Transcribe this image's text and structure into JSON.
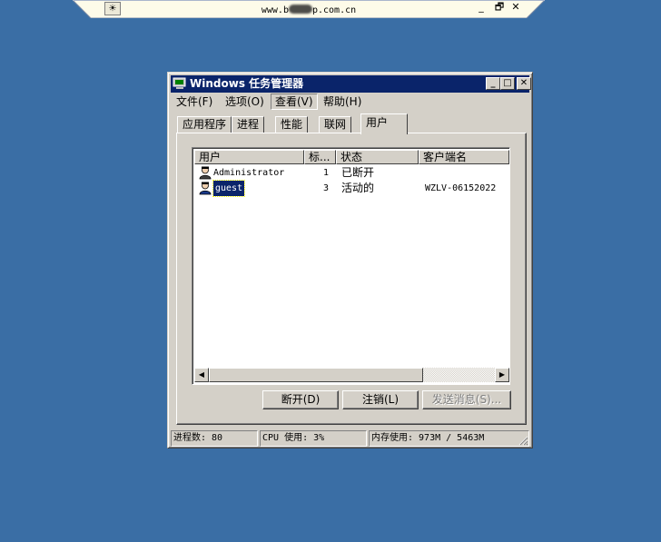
{
  "remote_bar": {
    "host_prefix": "www.b",
    "host_suffix": "p.com.cn",
    "pin_icon": "pushpin-icon",
    "minimize_glyph": "_",
    "restore_glyph": "🗗",
    "close_glyph": "✕"
  },
  "window": {
    "title": "Windows 任务管理器",
    "title_icon": "task-manager-icon",
    "minimize_glyph": "_",
    "maximize_glyph": "□",
    "close_glyph": "✕"
  },
  "menu": {
    "items": [
      "文件(F)",
      "选项(O)",
      "查看(V)",
      "帮助(H)"
    ]
  },
  "tabs": [
    "应用程序",
    "进程",
    "性能",
    "联网",
    "用户"
  ],
  "active_tab": "用户",
  "users_table": {
    "columns": [
      "用户",
      "标...",
      "状态",
      "客户端名"
    ],
    "rows": [
      {
        "user": "Administrator",
        "id": "1",
        "status": "已断开",
        "client": ""
      },
      {
        "user": "guest",
        "id": "3",
        "status": "活动的",
        "client": "WZLV-06152022"
      }
    ],
    "selected_row": 1
  },
  "buttons": {
    "disconnect": "断开(D)",
    "logoff": "注销(L)",
    "send_message": "发送消息(S)..."
  },
  "status_bar": {
    "processes": "进程数: 80",
    "cpu": "CPU 使用: 3%",
    "memory": "内存使用: 973M / 5463M"
  },
  "colors": {
    "desktop": "#3a6ea5",
    "titlebar": "#0a246a",
    "face": "#d4d0c8"
  }
}
